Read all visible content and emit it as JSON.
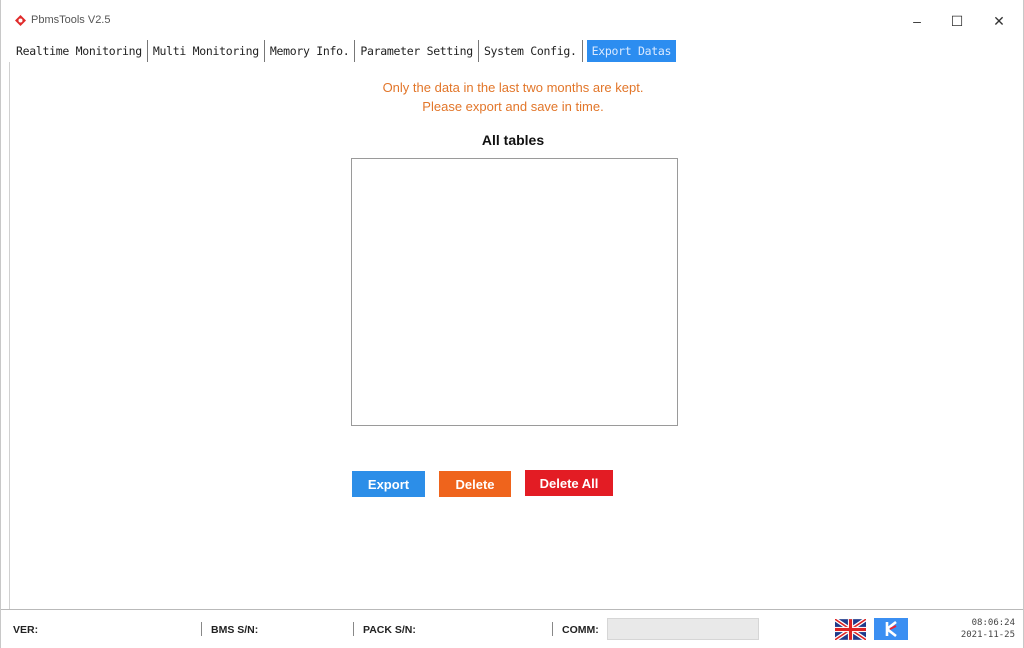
{
  "window": {
    "title": "PbmsTools V2.5",
    "controls": {
      "minimize": "–",
      "maximize": "☐",
      "close": "✕"
    }
  },
  "tabs": [
    {
      "label": "Realtime Monitoring",
      "active": false
    },
    {
      "label": "Multi Monitoring",
      "active": false
    },
    {
      "label": "Memory Info.",
      "active": false
    },
    {
      "label": "Parameter Setting",
      "active": false
    },
    {
      "label": "System Config.",
      "active": false
    },
    {
      "label": "Export Datas",
      "active": true
    }
  ],
  "main": {
    "notice_line1": "Only the data in the last two months are kept.",
    "notice_line2": "Please export and save in time.",
    "tables_title": "All tables",
    "buttons": {
      "export": "Export",
      "delete": "Delete",
      "delete_all": "Delete All"
    }
  },
  "statusbar": {
    "ver_label": "VER:",
    "bms_sn_label": "BMS S/N:",
    "pack_sn_label": "PACK S/N:",
    "comm_label": "COMM:",
    "comm_value": "",
    "time": "08:06:24",
    "date": "2021-11-25"
  },
  "colors": {
    "accent": "#2c8df0",
    "notice": "#e2762a",
    "export_button": "#2c8ee8",
    "delete_button": "#ef641c",
    "delete_all_button": "#e31c24"
  }
}
